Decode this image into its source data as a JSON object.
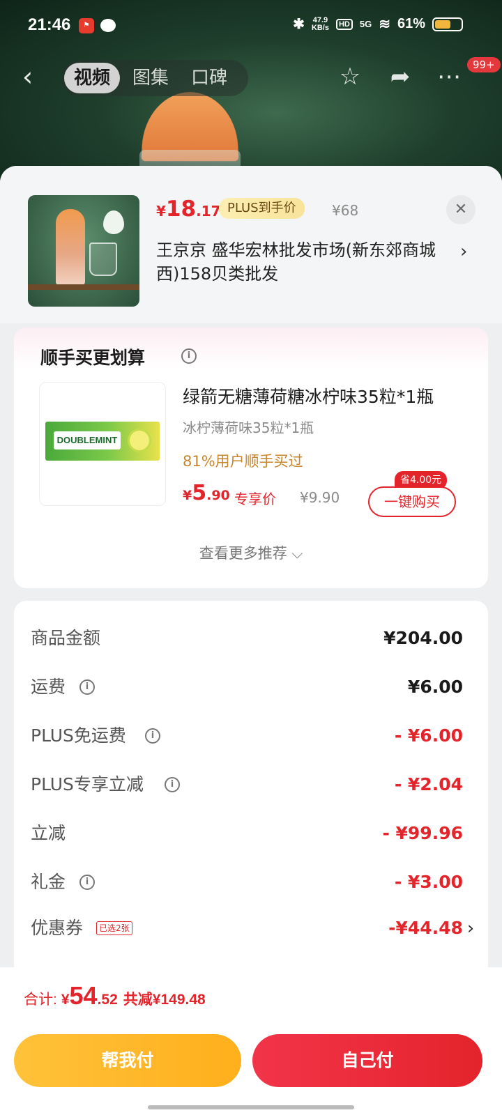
{
  "status_bar": {
    "time": "21:46",
    "net_speed": "47.9\nKB/s",
    "battery": "61%",
    "signal": "5G"
  },
  "top_nav": {
    "tabs": [
      "视频",
      "图集",
      "口碑"
    ],
    "active_tab": "视频",
    "badge": "99+"
  },
  "product": {
    "price_currency": "¥",
    "price_int": "18",
    "price_dec": ".17",
    "plus_tag": "PLUS到手价",
    "original_price": "¥68",
    "shop_name": "王京京  盛华宏林批发市场(新东郊商城西)158贝类批发"
  },
  "upsell": {
    "title": "顺手买更划算",
    "item_name": "绿箭无糖薄荷糖冰柠味35粒*1瓶",
    "item_spec": "冰柠薄荷味35粒*1瓶",
    "bought_ratio": "81%用户顺手买过",
    "price_currency": "¥",
    "price_int": "5",
    "price_dec": ".90",
    "price_label": "专享价",
    "original_price": "¥9.90",
    "save_tag": "省4.00元",
    "buy_button": "一键购买",
    "more_label": "查看更多推荐 ⌵",
    "gum_brand": "DOUBLEMINT"
  },
  "summary": {
    "rows": [
      {
        "label": "商品金额",
        "value": "¥204.00",
        "info": false,
        "red": false
      },
      {
        "label": "运费",
        "value": "¥6.00",
        "info": true,
        "red": false
      },
      {
        "label": "PLUS免运费",
        "value": "- ¥6.00",
        "info": true,
        "red": true
      },
      {
        "label": "PLUS专享立减",
        "value": "- ¥2.04",
        "info": true,
        "red": true
      },
      {
        "label": "立减",
        "value": "- ¥99.96",
        "info": false,
        "red": true
      },
      {
        "label": "礼金",
        "value": "- ¥3.00",
        "info": true,
        "red": true
      },
      {
        "label": "优惠券",
        "value": "-¥44.48",
        "info": false,
        "red": true
      }
    ],
    "coupon_tag": "已选2张"
  },
  "bottom": {
    "total_label": "合计:",
    "total_currency": "¥",
    "total_int": "54",
    "total_dec": ".52",
    "total_save": "共减¥149.48",
    "help_pay": "帮我付",
    "self_pay": "自己付"
  },
  "colors": {
    "accent_red": "#e4242b",
    "gold": "#ffc23a"
  }
}
